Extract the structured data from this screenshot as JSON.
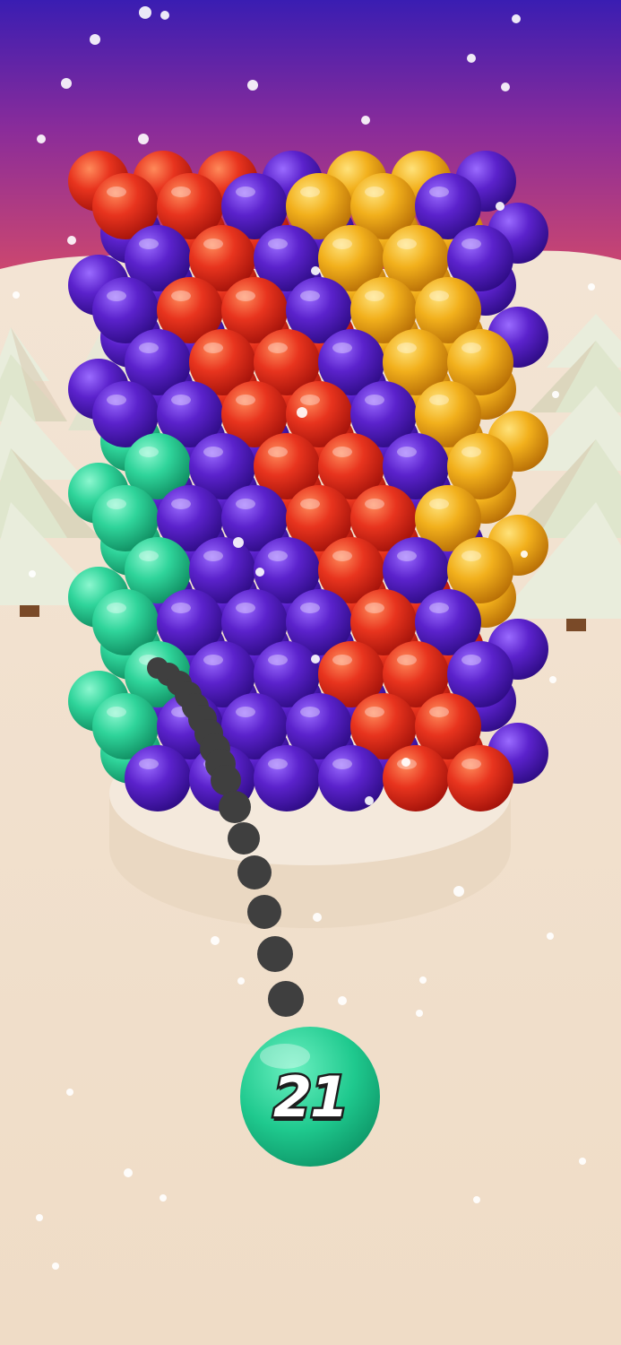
{
  "colors": {
    "sky_top": "#3d1fb5",
    "sky_bottom": "#d24a6e",
    "ground": "#efdcc8",
    "pedestal": "#f2e6d6",
    "purple": "#5a1fc4",
    "red": "#e8301e",
    "yellow": "#f2b21c",
    "green": "#2dd69a",
    "aim_dot": "#3f3f3f",
    "snow": "#ffffff"
  },
  "tower_colors": [
    "purple",
    "red",
    "yellow",
    "green"
  ],
  "shooter": {
    "color": "green",
    "count": "21"
  },
  "icons": {
    "tree": "pine-tree-icon",
    "snow": "snowflake-dot"
  }
}
